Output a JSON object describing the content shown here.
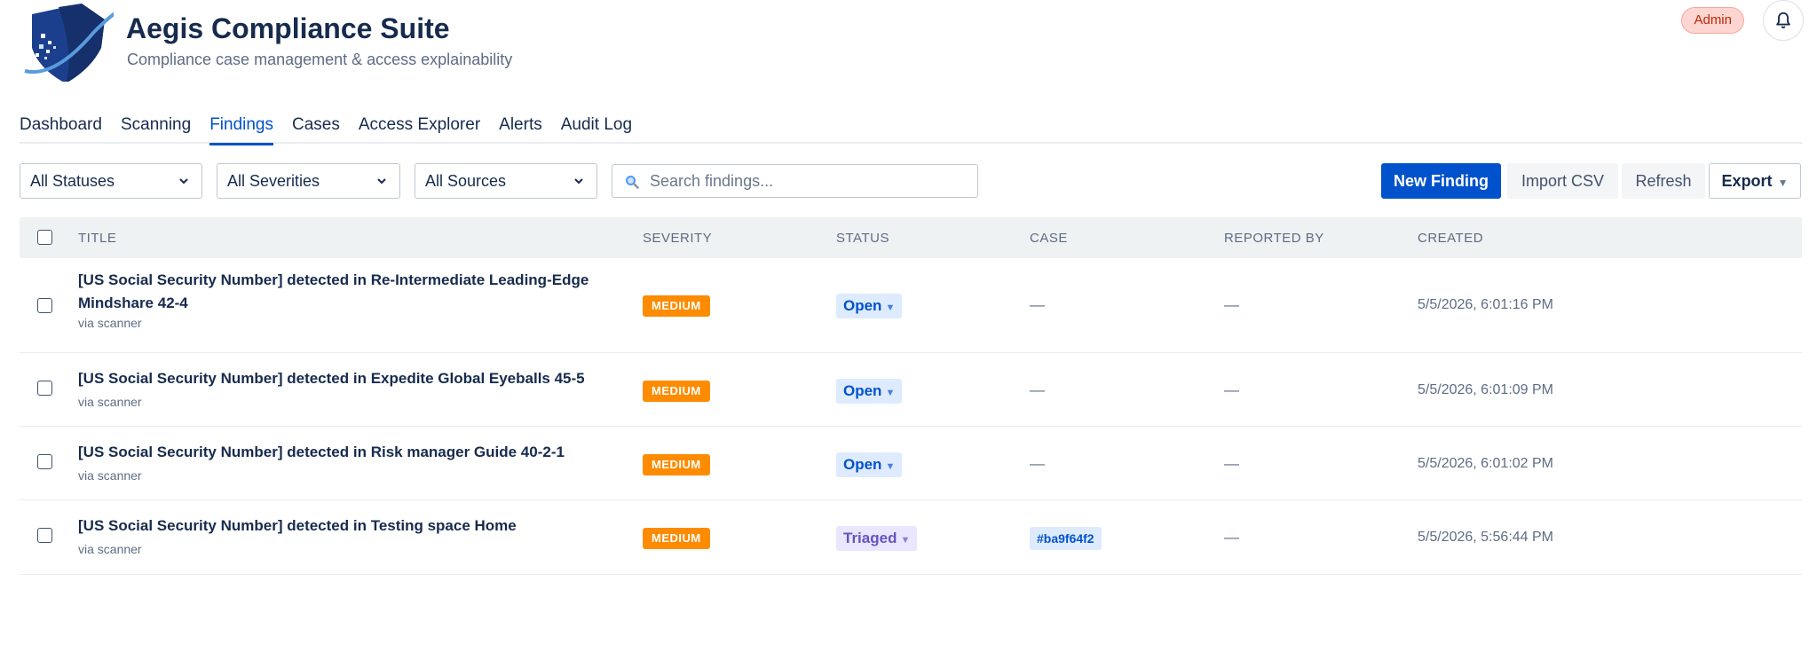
{
  "app": {
    "title": "Aegis Compliance Suite",
    "subtitle": "Compliance case management & access explainability",
    "role_badge": "Admin"
  },
  "nav": {
    "tabs": [
      {
        "label": "Dashboard",
        "active": false
      },
      {
        "label": "Scanning",
        "active": false
      },
      {
        "label": "Findings",
        "active": true
      },
      {
        "label": "Cases",
        "active": false
      },
      {
        "label": "Access Explorer",
        "active": false
      },
      {
        "label": "Alerts",
        "active": false
      },
      {
        "label": "Audit Log",
        "active": false
      }
    ]
  },
  "filters": {
    "status": "All Statuses",
    "severity": "All Severities",
    "source": "All Sources",
    "search_placeholder": "Search findings...",
    "search_value": ""
  },
  "actions": {
    "new_finding": "New Finding",
    "import_csv": "Import CSV",
    "refresh": "Refresh",
    "export": "Export"
  },
  "table": {
    "columns": {
      "title": "TITLE",
      "severity": "SEVERITY",
      "status": "STATUS",
      "case": "CASE",
      "reported_by": "REPORTED BY",
      "created": "CREATED"
    },
    "rows": [
      {
        "title_line1": "[US Social Security Number] detected in Re-Intermediate Leading-Edge",
        "title_line2": "Mindshare 42-4",
        "source": "via scanner",
        "severity": "MEDIUM",
        "status": "Open",
        "case": "—",
        "reported_by": "—",
        "created": "5/5/2026, 6:01:16 PM"
      },
      {
        "title_line1": "[US Social Security Number] detected in Expedite Global Eyeballs 45-5",
        "title_line2": "",
        "source": "via scanner",
        "severity": "MEDIUM",
        "status": "Open",
        "case": "—",
        "reported_by": "—",
        "created": "5/5/2026, 6:01:09 PM"
      },
      {
        "title_line1": "[US Social Security Number] detected in Risk manager Guide 40-2-1",
        "title_line2": "",
        "source": "via scanner",
        "severity": "MEDIUM",
        "status": "Open",
        "case": "—",
        "reported_by": "—",
        "created": "5/5/2026, 6:01:02 PM"
      },
      {
        "title_line1": "[US Social Security Number] detected in Testing space Home",
        "title_line2": "",
        "source": "via scanner",
        "severity": "MEDIUM",
        "status": "Triaged",
        "case": "#ba9f64f2",
        "reported_by": "—",
        "created": "5/5/2026, 5:56:44 PM"
      }
    ]
  },
  "colors": {
    "primary": "#0052cc",
    "severity_medium": "#ff8b00",
    "status_open_bg": "#deebff",
    "status_triaged_bg": "#eae6ff",
    "admin_badge_bg": "#ffd5d2"
  },
  "icons": {
    "logo": "shield-logo-icon",
    "notifications": "bell-icon",
    "search": "search-icon",
    "dropdown": "chevron-down-icon"
  }
}
